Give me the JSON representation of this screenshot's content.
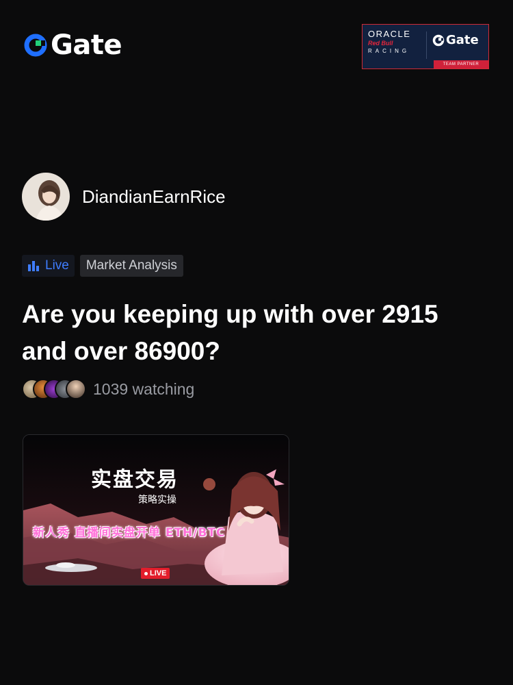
{
  "header": {
    "brand": "Gate",
    "partner": {
      "oracle": "ORACLE",
      "redbull": "Red Bull",
      "racing": "RACING",
      "gate": "Gate",
      "badge": "TEAM PARTNER"
    }
  },
  "host": {
    "name": "DiandianEarnRice"
  },
  "tags": {
    "live": "Live",
    "category": "Market Analysis"
  },
  "stream": {
    "title": "Are you keeping up with over 2915 and over 86900?",
    "watching": "1039 watching"
  },
  "thumbnail": {
    "title": "实盘交易",
    "subtitle": "策略实操",
    "banner": "新人秀 直播间实盘开单 ETH/BTC",
    "live_badge": "LIVE"
  },
  "colors": {
    "background": "#0b0b0c",
    "accent_blue": "#3f7dff",
    "live_red": "#e31d2b",
    "gate_blue": "#1f6fff",
    "gate_green": "#22d07a"
  }
}
